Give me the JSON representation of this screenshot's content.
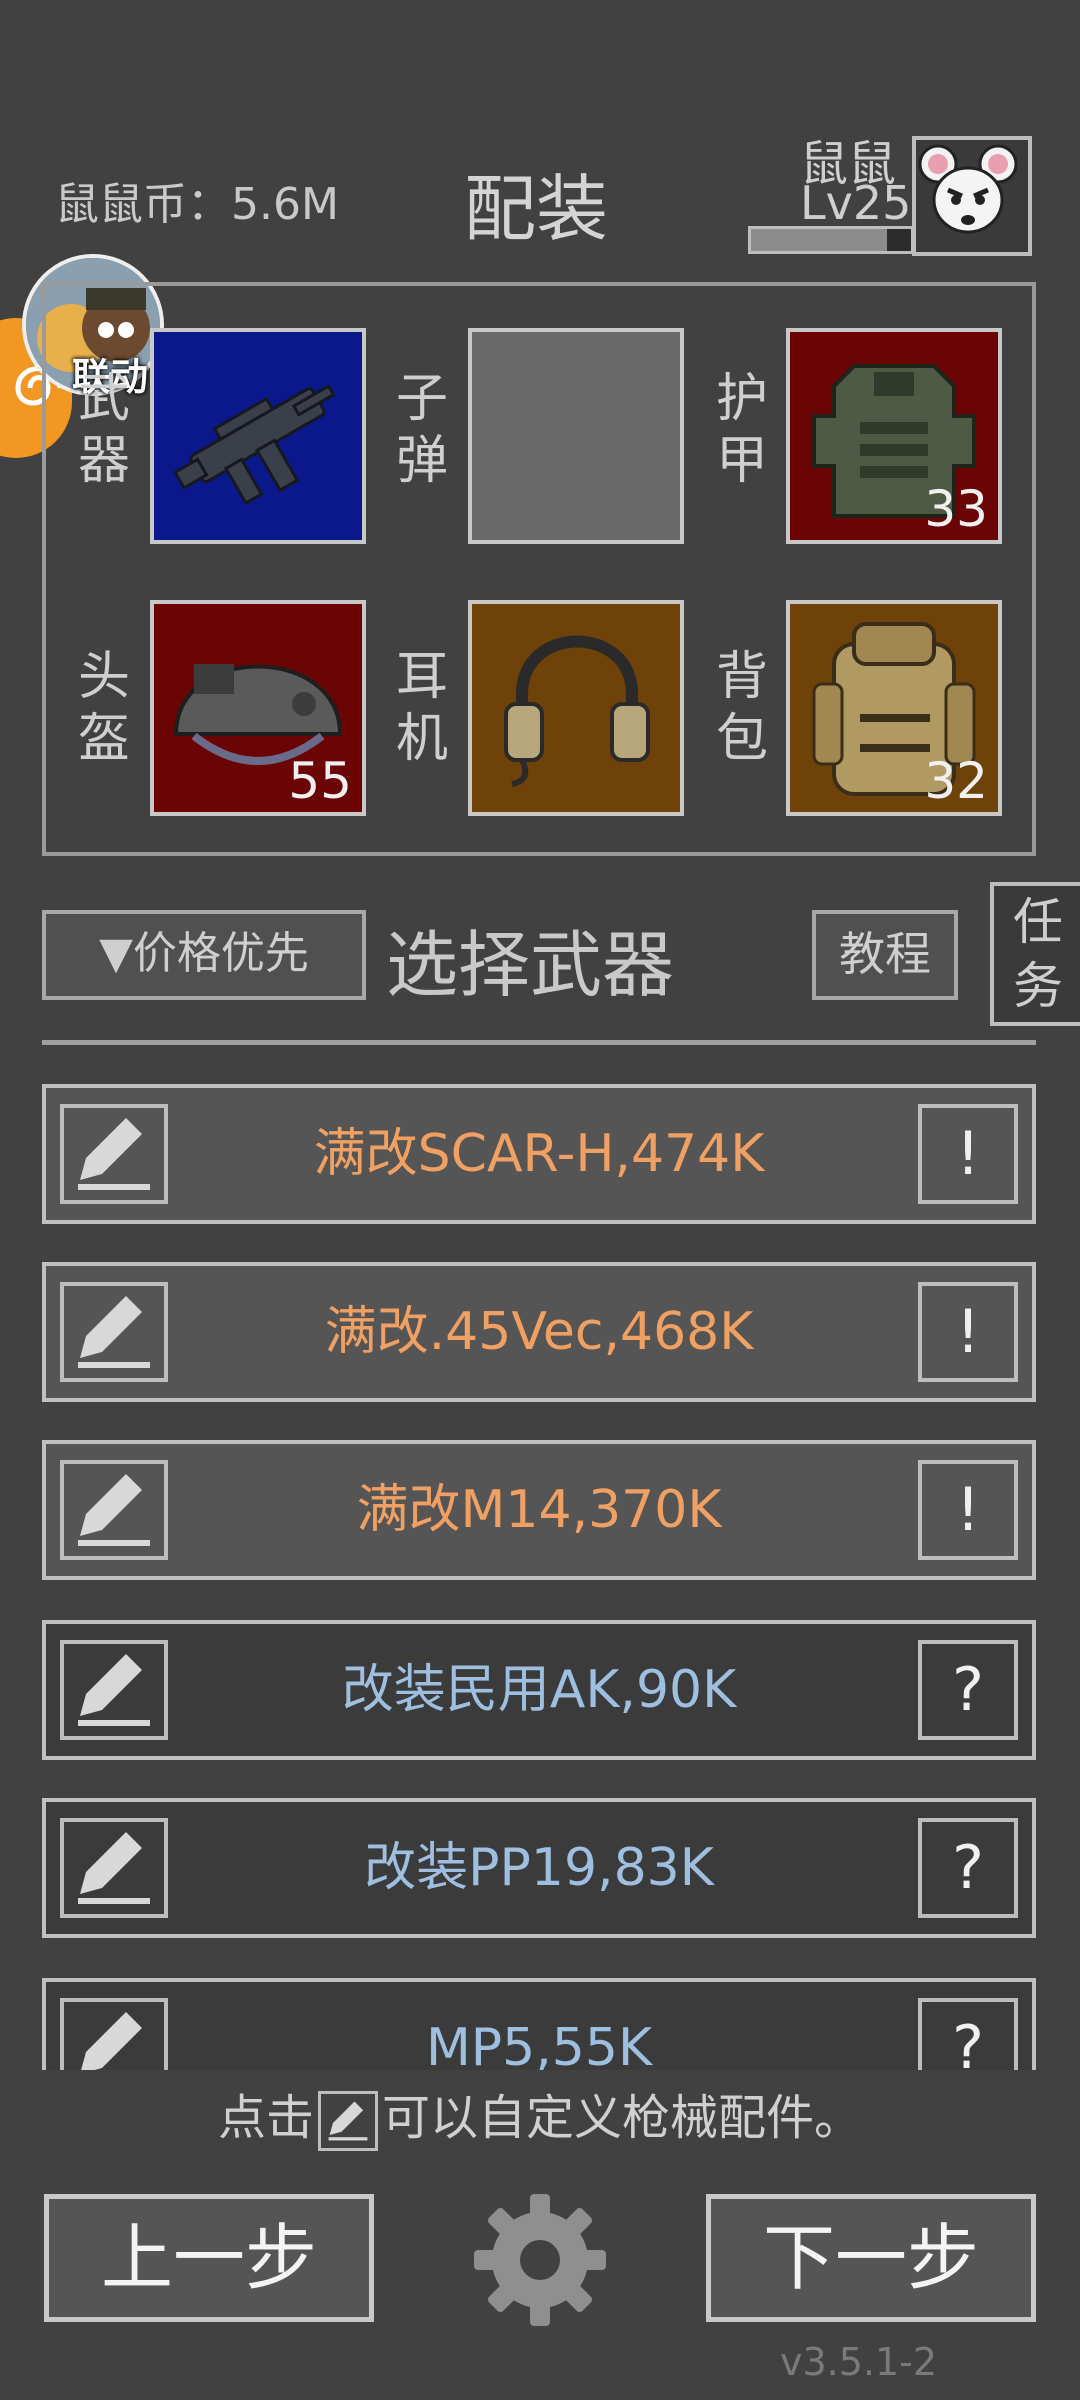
{
  "header": {
    "coins": "鼠鼠币：5.6M",
    "title": "配装",
    "player_name": "鼠鼠",
    "player_level": "Lv25"
  },
  "event": {
    "label": "联动"
  },
  "equipment": {
    "weapon_label": "武器",
    "ammo_label": "子弹",
    "armor_label": "护甲",
    "helmet_label": "头盔",
    "headset_label": "耳机",
    "backpack_label": "背包",
    "armor_count": "33",
    "helmet_count": "55",
    "backpack_count": "32"
  },
  "controls": {
    "sort": "▼价格优先",
    "select_title": "选择武器",
    "tutorial": "教程",
    "task": "任务"
  },
  "weapons": [
    {
      "name": "满改SCAR-H,474K",
      "badge": "!"
    },
    {
      "name": "满改.45Vec,468K",
      "badge": "!"
    },
    {
      "name": "满改M14,370K",
      "badge": "!"
    },
    {
      "name": "改装民用AK,90K",
      "badge": "?"
    },
    {
      "name": "改装PP19,83K",
      "badge": "?"
    },
    {
      "name": "MP5,55K",
      "badge": "?"
    }
  ],
  "hint": {
    "before": "点击",
    "after": "可以自定义枪械配件。"
  },
  "nav": {
    "prev": "上一步",
    "next": "下一步"
  },
  "version": "v3.5.1-2",
  "colors": {
    "modded_text": "#f0a062",
    "plain_text": "#9fbfe0",
    "event_tab": "#f19722"
  }
}
